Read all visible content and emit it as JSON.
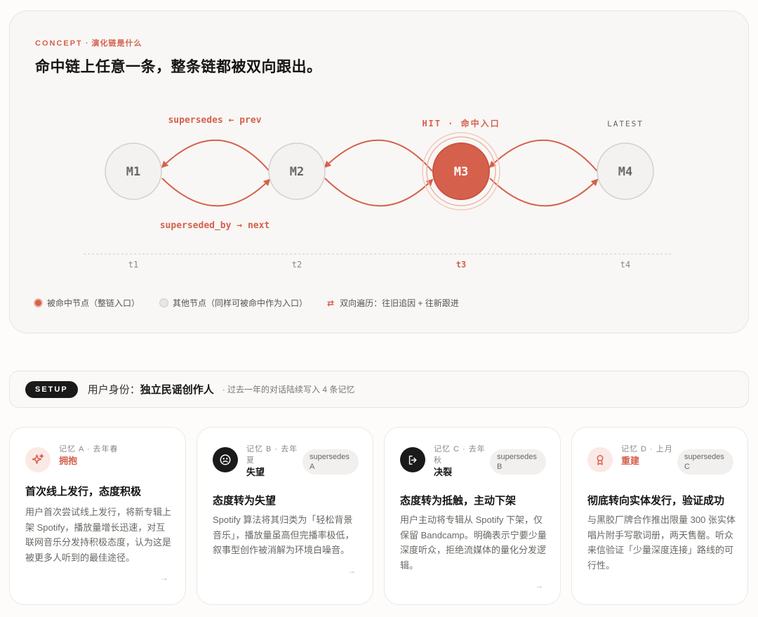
{
  "concept": {
    "eyebrow_en": "CONCEPT",
    "eyebrow_cn": " · 演化链是什么",
    "headline": "命中链上任意一条，整条链都被双向跟出。"
  },
  "chain": {
    "nodes": [
      {
        "label": "M1",
        "time": "t1",
        "hit": false
      },
      {
        "label": "M2",
        "time": "t2",
        "hit": false
      },
      {
        "label": "M3",
        "time": "t3",
        "hit": true
      },
      {
        "label": "M4",
        "time": "t4",
        "hit": false
      }
    ],
    "top_label": "supersedes ← prev",
    "bottom_label": "superseded_by → next",
    "hit_label": "HIT · 命中入口",
    "latest_label": "LATEST",
    "colors": {
      "accent": "#d5614c",
      "node_fill": "#f3f2f0",
      "node_border": "#d3d0cc"
    }
  },
  "legend": {
    "hit": "被命中节点（整链入口）",
    "other": "其他节点（同样可被命中作为入口）",
    "arrows": "⇄",
    "traverse": "双向遍历：往旧追因 + 往新跟进"
  },
  "setup": {
    "pill": "SETUP",
    "identity_label": "用户身份：",
    "identity_value": "独立民谣创作人",
    "note": "· 过去一年的对话陆续写入 4 条记忆"
  },
  "cards": [
    {
      "icon": "sparkle-icon",
      "meta_key": "记忆 A · 去年春",
      "meta_value": "拥抱",
      "tag": "",
      "title": "首次线上发行，态度积极",
      "body": "用户首次尝试线上发行，将新专辑上架 Spotify，播放量增长迅速，对互联网音乐分发持积极态度，认为这是被更多人听到的最佳途径。"
    },
    {
      "icon": "frown-face-icon",
      "meta_key": "记忆 B · 去年夏",
      "meta_value": "失望",
      "tag": "supersedes A",
      "title": "态度转为失望",
      "body": "Spotify 算法将其归类为「轻松背景音乐」，播放量虽高但完播率极低，叙事型创作被消解为环境白噪音。"
    },
    {
      "icon": "exit-arrow-icon",
      "meta_key": "记忆 C · 去年秋",
      "meta_value": "决裂",
      "tag": "supersedes B",
      "title": "态度转为抵触，主动下架",
      "body": "用户主动将专辑从 Spotify 下架，仅保留 Bandcamp。明确表示宁要少量深度听众，拒绝流媒体的量化分发逻辑。"
    },
    {
      "icon": "award-ribbon-icon",
      "meta_key": "记忆 D · 上月",
      "meta_value": "重建",
      "tag": "supersedes C",
      "title": "彻底转向实体发行，验证成功",
      "body": "与黑胶厂牌合作推出限量 300 张实体唱片附手写歌词册，两天售罄。听众来信验证「少量深度连接」路线的可行性。"
    }
  ],
  "card_arrow": "→"
}
